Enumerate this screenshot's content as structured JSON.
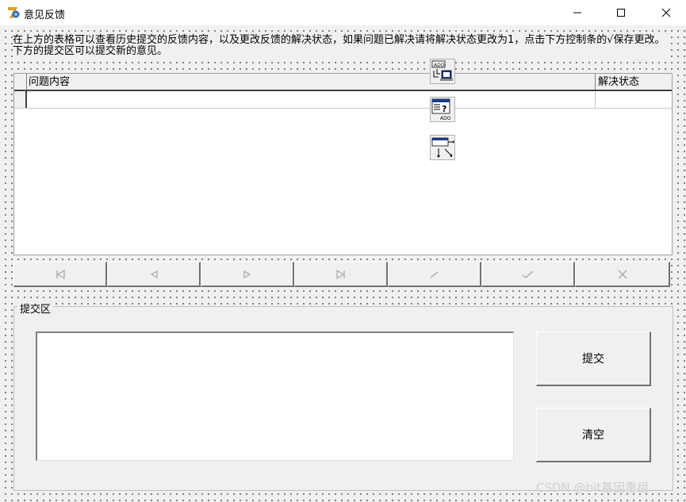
{
  "window": {
    "title": "意见反馈",
    "icon": "delphi-app-icon",
    "controls": [
      "minimize-icon",
      "maximize-icon",
      "close-icon"
    ]
  },
  "instruction": "在上方的表格可以查看历史提交的反馈内容，以及更改反馈的解决状态，如果问题已解决请将解决状态更改为1，点击下方控制条的√保存更改。下方的提交区可以提交新的意见。",
  "grid": {
    "columns": [
      "问题内容",
      "解决状态"
    ],
    "rows": [
      [
        "",
        ""
      ]
    ]
  },
  "components": [
    "ado-connection-icon",
    "ado-query-icon",
    "data-source-icon"
  ],
  "navigator": {
    "buttons": [
      "first-record-icon",
      "prior-record-icon",
      "next-record-icon",
      "last-record-icon",
      "edit-record-icon",
      "post-record-icon",
      "cancel-record-icon"
    ]
  },
  "submit_area": {
    "label": "提交区",
    "memo_value": "",
    "submit_label": "提交",
    "clear_label": "清空"
  },
  "watermark": "CSDN @bit基因重组"
}
